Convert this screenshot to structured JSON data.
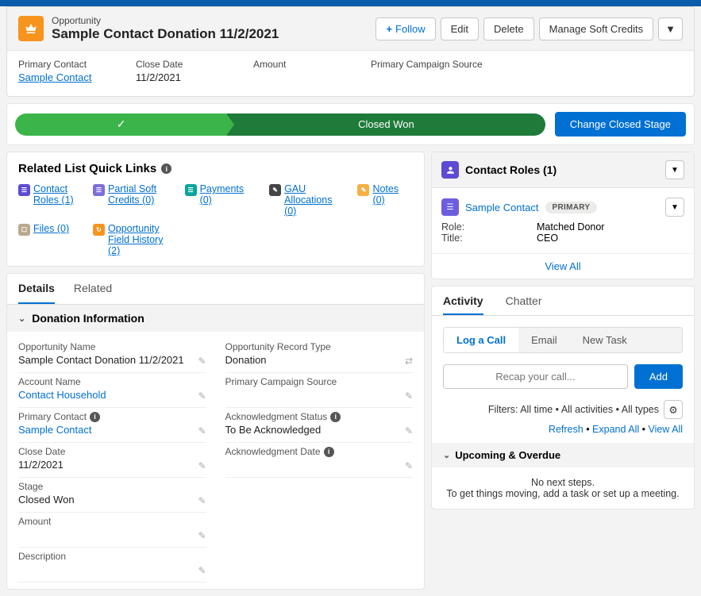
{
  "header": {
    "type_label": "Opportunity",
    "title": "Sample Contact Donation 11/2/2021",
    "follow": "Follow",
    "edit": "Edit",
    "delete": "Delete",
    "manage_soft": "Manage Soft Credits",
    "fields": {
      "primary_contact_label": "Primary Contact",
      "primary_contact_value": "Sample Contact",
      "close_date_label": "Close Date",
      "close_date_value": "11/2/2021",
      "amount_label": "Amount",
      "amount_value": "",
      "campaign_label": "Primary Campaign Source",
      "campaign_value": ""
    }
  },
  "stage": {
    "closed_won": "Closed Won",
    "change_btn": "Change Closed Stage"
  },
  "quicklinks": {
    "title": "Related List Quick Links",
    "contact_roles": "Contact Roles (1)",
    "partial_soft": "Partial Soft Credits (0)",
    "payments": "Payments (0)",
    "gau": "GAU Allocations (0)",
    "notes": "Notes (0)",
    "files": "Files (0)",
    "ofh": "Opportunity Field History (2)"
  },
  "tabs": {
    "details": "Details",
    "related": "Related"
  },
  "section": {
    "donation_info": "Donation Information"
  },
  "details": {
    "opp_name_label": "Opportunity Name",
    "opp_name_value": "Sample Contact Donation 11/2/2021",
    "record_type_label": "Opportunity Record Type",
    "record_type_value": "Donation",
    "account_label": "Account Name",
    "account_value": "Contact Household",
    "campaign_label": "Primary Campaign Source",
    "campaign_value": "",
    "primary_contact_label": "Primary Contact",
    "primary_contact_value": "Sample Contact",
    "ack_status_label": "Acknowledgment Status",
    "ack_status_value": "To Be Acknowledged",
    "close_date_label": "Close Date",
    "close_date_value": "11/2/2021",
    "ack_date_label": "Acknowledgment Date",
    "ack_date_value": "",
    "stage_label": "Stage",
    "stage_value": "Closed Won",
    "amount_label": "Amount",
    "amount_value": "",
    "desc_label": "Description",
    "desc_value": ""
  },
  "contact_roles": {
    "title": "Contact Roles (1)",
    "name": "Sample Contact",
    "badge": "PRIMARY",
    "role_label": "Role:",
    "role_value": "Matched Donor",
    "title_label": "Title:",
    "title_value": "CEO",
    "view_all": "View All"
  },
  "activity": {
    "tab_activity": "Activity",
    "tab_chatter": "Chatter",
    "log_call": "Log a Call",
    "email": "Email",
    "new_task": "New Task",
    "recap_placeholder": "Recap your call...",
    "add": "Add",
    "filters": "Filters: All time • All activities • All types",
    "refresh": "Refresh",
    "expand": "Expand All",
    "viewall": "View All",
    "upcoming": "Upcoming & Overdue",
    "no_next1": "No next steps.",
    "no_next2": "To get things moving, add a task or set up a meeting."
  }
}
